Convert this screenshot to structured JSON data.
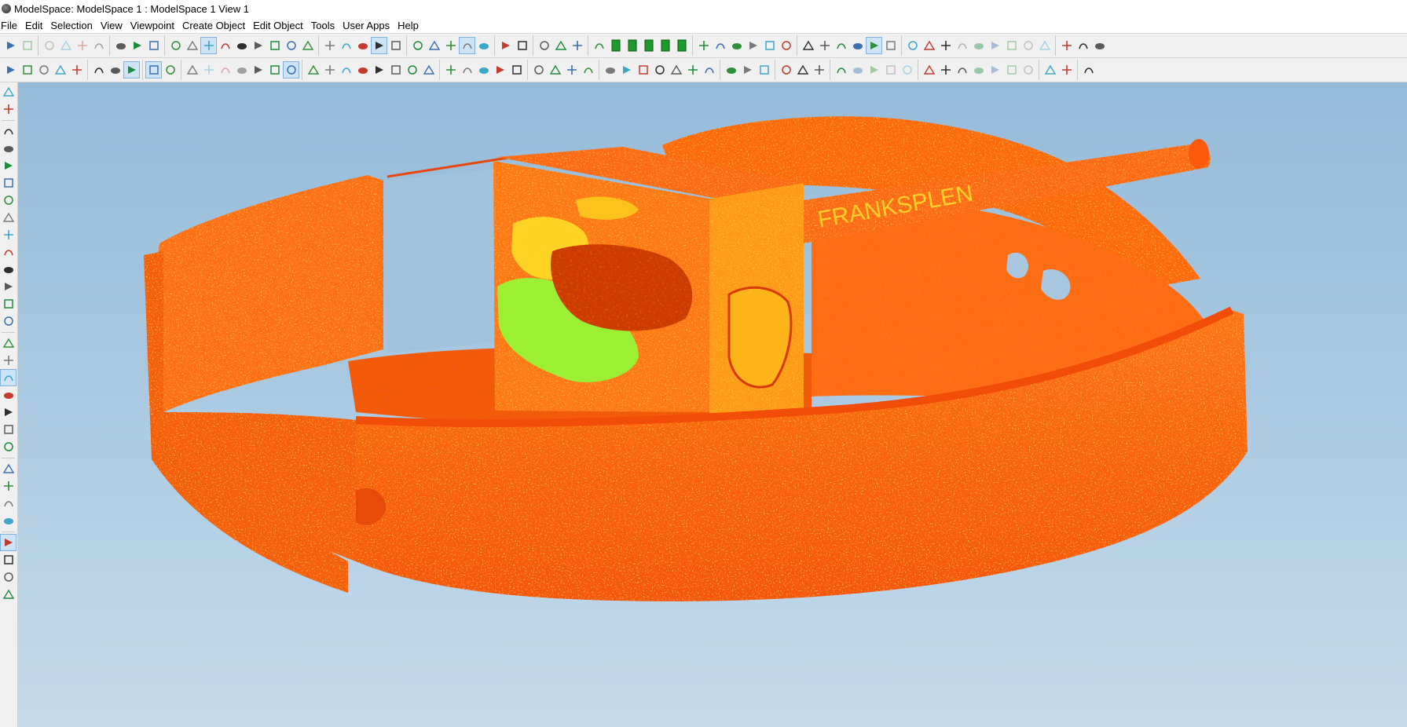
{
  "window": {
    "title": "ModelSpace: ModelSpace 1 : ModelSpace 1 View 1"
  },
  "menu": {
    "items": [
      "File",
      "Edit",
      "Selection",
      "View",
      "Viewpoint",
      "Create Object",
      "Edit Object",
      "Tools",
      "User Apps",
      "Help"
    ]
  },
  "toolbar_icons": {
    "row1": [
      "undo-icon",
      "redo-icon",
      "cut-icon",
      "copy-icon",
      "paste-icon",
      "delete-icon",
      "group-icon",
      "ungroup-icon",
      "merge-icon",
      "select-arrow-icon",
      "select-pick-icon",
      "pan-hand-icon",
      "pencil-icon",
      "move-icon",
      "rotate-icon",
      "target-icon",
      "lasso-icon",
      "rectangle-fence-icon",
      "circle-fence-icon",
      "polygon-fence-icon",
      "eraser-icon",
      "cube-icon",
      "seek-icon",
      "visualize-icon",
      "color-map-icon",
      "plot-icon",
      "orbit-icon",
      "walk-icon",
      "fly-icon",
      "examine-icon",
      "layer-icon",
      "grid-icon",
      "grid-dots-icon",
      "render-icon",
      "green-bar-1-icon",
      "green-bar-2-icon",
      "green-bar-3-icon",
      "green-bar-4-icon",
      "green-bar-5-icon",
      "pipe-icon",
      "book-icon",
      "bookmark-icon",
      "slice-icon",
      "slice-2-icon",
      "slice-3-icon",
      "link-icon",
      "link-2-icon",
      "measure-icon",
      "axis-icon",
      "axis-2-icon",
      "align-icon",
      "align-2-icon",
      "align-3-icon",
      "align-4-icon",
      "measure-dim-icon",
      "measure-dim-2-icon",
      "measure-dim-3-icon",
      "measure-dim-4-icon",
      "measure-dim-5-icon",
      "measure-dim-6-icon",
      "settings-icon",
      "camera-icon",
      "photo-icon"
    ],
    "row2": [
      "layers-icon",
      "layer-visibility-icon",
      "layer-show-icon",
      "layer-select-icon",
      "layer-tool-icon",
      "axis-x-icon",
      "axis-y-icon",
      "axis-z-icon",
      "up-arrow-icon",
      "box-icon",
      "box-2-icon",
      "move-3d-icon",
      "explode-icon",
      "constraint-icon",
      "globe-icon",
      "snap-icon",
      "snap-2-icon",
      "plane-1-icon",
      "plane-2-icon",
      "plane-3-icon",
      "plane-4-icon",
      "plane-5-icon",
      "plane-6-icon",
      "branch-icon",
      "fork-icon",
      "fit-x-icon",
      "fit-y-icon",
      "fit-z-icon",
      "fit-all-icon",
      "cloud-icon",
      "cylinder-icon",
      "cylinder-2-icon",
      "cylinder-3-icon",
      "split-icon",
      "mirror-1-icon",
      "mirror-2-icon",
      "mirror-3-icon",
      "add-point-icon",
      "node-icon",
      "node-2-icon",
      "node-3-icon",
      "grid-fine-icon",
      "slash-grid-icon",
      "angle-icon",
      "paint-icon",
      "light-icon",
      "dots-icon",
      "copy-obj-icon",
      "copy-obj-2-icon",
      "edit-1-icon",
      "edit-2-icon",
      "cut-obj-icon",
      "chair-icon",
      "chair-2-icon",
      "chair-3-icon",
      "cloud-obj-1-icon",
      "cloud-obj-2-icon",
      "cloud-obj-3-icon",
      "cloud-obj-4-icon",
      "square-icon",
      "circle-icon",
      "close-icon"
    ],
    "left": [
      "measure-tool-icon",
      "swap-icon",
      "orbit-1-icon",
      "orbit-2-icon",
      "orbit-3-icon",
      "orbit-4-icon",
      "view-1-icon",
      "view-2-icon",
      "view-3-icon",
      "view-4-icon",
      "view-5-icon",
      "view-6-icon",
      "view-7-icon",
      "view-8-icon",
      "layers-stack-icon",
      "layer-mode-icon",
      "active-tool-icon",
      "color-tool-icon",
      "globe-tool-icon",
      "constraint-tool-icon",
      "dim-tool-icon",
      "plane-tool-1-icon",
      "plane-tool-2-icon",
      "plane-tool-3-icon",
      "plane-tool-4-icon",
      "active-tool-2-icon",
      "color-globe-1-icon",
      "color-globe-2-icon",
      "color-globe-3-icon"
    ]
  },
  "viewport": {
    "description_hidden": true,
    "colors": {
      "sky_top": "#96bbd9",
      "sky_bottom": "#c6dbeb",
      "cloud_main": "#ff6a10",
      "cloud_dark": "#ee4a08",
      "cloud_light": "#ff9a1a",
      "cloud_yellow": "#ffd21f",
      "cloud_green": "#8fee2a"
    },
    "graffiti": [
      "FRANKSPLEN"
    ]
  }
}
